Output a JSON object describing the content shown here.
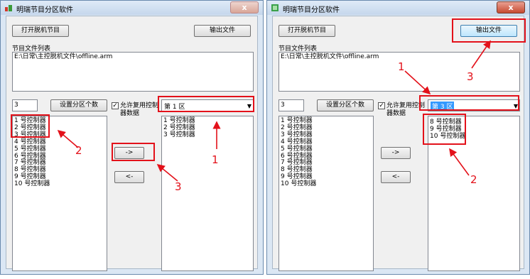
{
  "left_window": {
    "title": "明瑞节目分区软件",
    "close": "x",
    "open_button": "打开脱机节目",
    "export_button": "输出文件",
    "file_list_label": "节目文件列表",
    "file_path": "E:\\日常\\主控脱机文件\\offline.arm",
    "partition_count_value": "3",
    "set_partition_button": "设置分区个数",
    "allow_reuse_label_1": "允许复用控制",
    "allow_reuse_label_2": "器数据",
    "allow_reuse_checked": "✓",
    "controllers": [
      "1 号控制器",
      "2 号控制器",
      "3 号控制器",
      "4 号控制器",
      "5 号控制器",
      "6 号控制器",
      "7 号控制器",
      "8 号控制器",
      "9 号控制器",
      "10 号控制器"
    ],
    "zone_selected": "第 1 区",
    "zone_items": [
      "1 号控制器",
      "2 号控制器",
      "3 号控制器"
    ],
    "move_right_button": "->",
    "move_left_button": "<-",
    "annotations": [
      "1",
      "2",
      "3"
    ]
  },
  "right_window": {
    "title": "明瑞节目分区软件",
    "close": "x",
    "open_button": "打开脱机节目",
    "export_button": "输出文件",
    "file_list_label": "节目文件列表",
    "file_path": "E:\\日常\\主控脱机文件\\offline.arm",
    "partition_count_value": "3",
    "set_partition_button": "设置分区个数",
    "allow_reuse_label_1": "允许复用控制",
    "allow_reuse_label_2": "器数据",
    "allow_reuse_checked": "✓",
    "controllers": [
      "1 号控制器",
      "2 号控制器",
      "3 号控制器",
      "4 号控制器",
      "5 号控制器",
      "6 号控制器",
      "7 号控制器",
      "8 号控制器",
      "9 号控制器",
      "10 号控制器"
    ],
    "zone_selected": "第 3 区",
    "zone_items": [
      "8 号控制器",
      "9 号控制器",
      "10 号控制器"
    ],
    "move_right_button": "->",
    "move_left_button": "<-",
    "annotations": [
      "1",
      "2",
      "3"
    ]
  },
  "colors": {
    "annotation_red": "#e3111a",
    "selection_blue": "#3399ff"
  }
}
